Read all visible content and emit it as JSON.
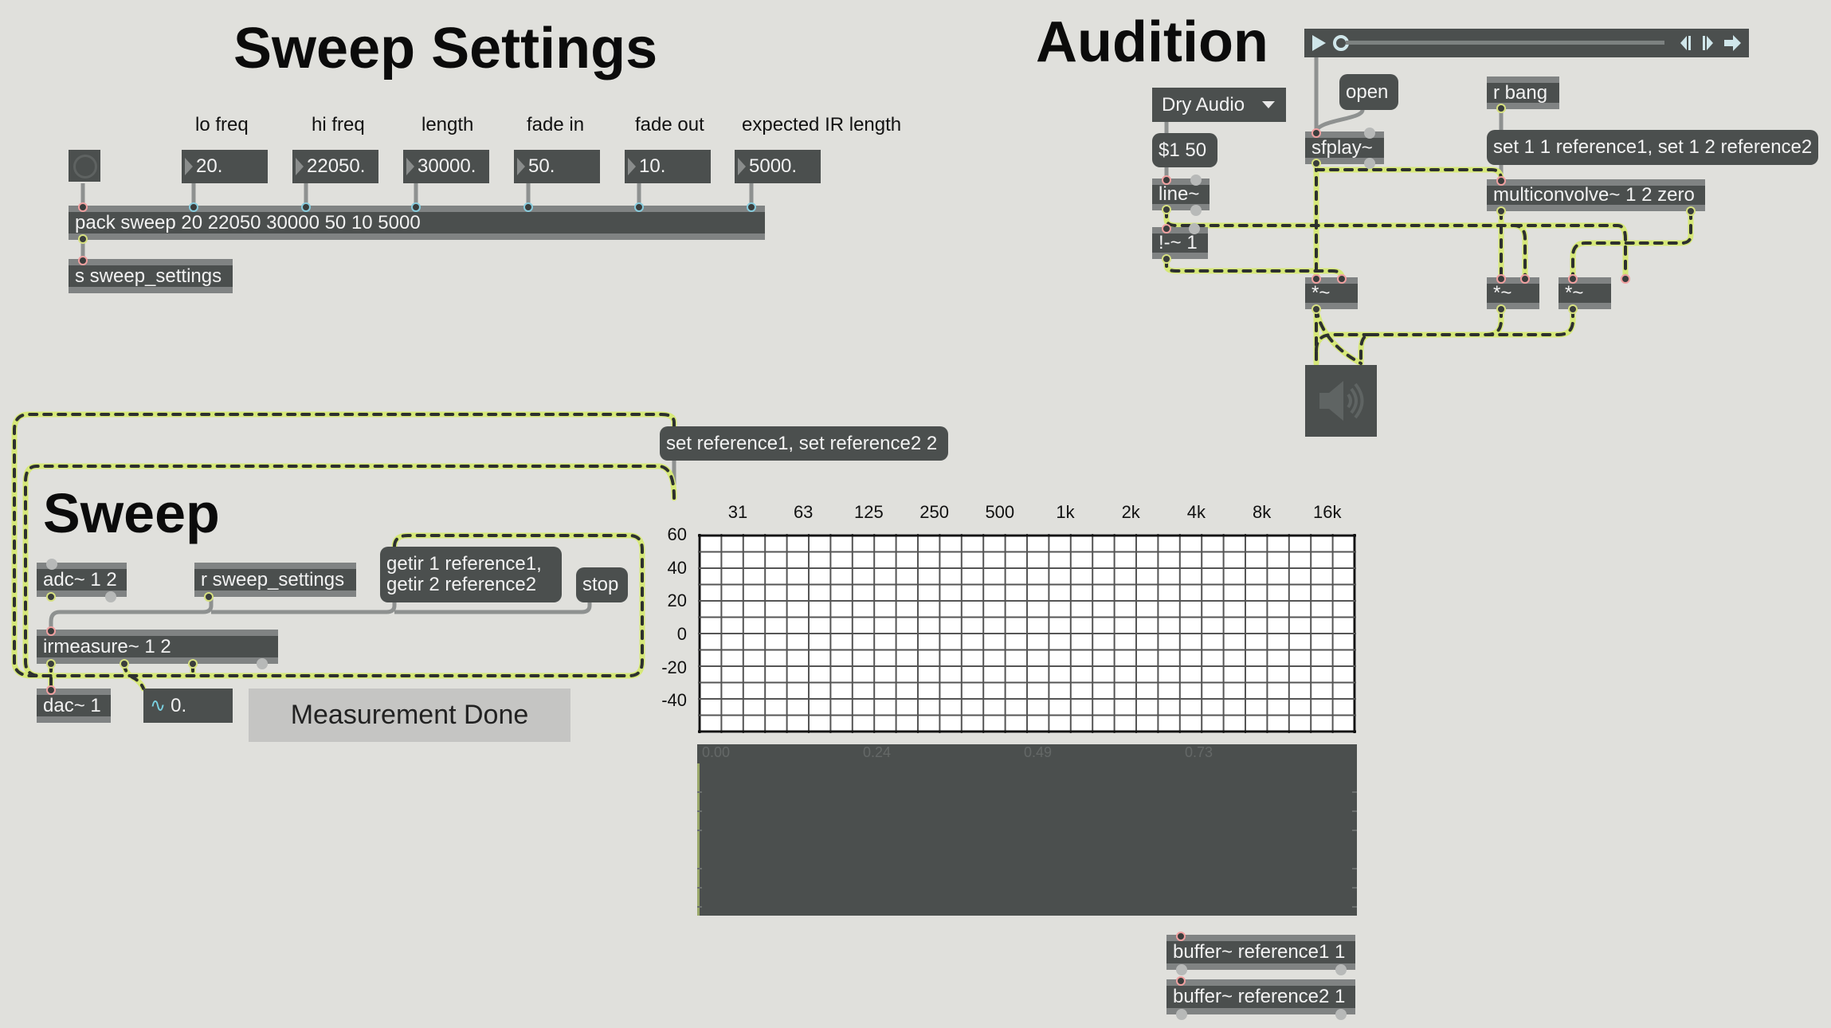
{
  "headings": {
    "sweep_settings": "Sweep Settings",
    "audition": "Audition",
    "sweep": "Sweep"
  },
  "sweep_settings": {
    "param_labels": [
      "lo freq",
      "hi freq",
      "length",
      "fade in",
      "fade out",
      "expected IR length"
    ],
    "param_values": [
      "20.",
      "22050.",
      "30000.",
      "50.",
      "10.",
      "5000."
    ],
    "pack_object": "pack sweep 20 22050 30000 50 10 5000",
    "send_object": "s sweep_settings"
  },
  "audition": {
    "player": {
      "position": 0.0,
      "icons": [
        "play-icon",
        "scrub-handle",
        "step-back-icon",
        "step-forward-icon",
        "loop-icon"
      ]
    },
    "menu_selected": "Dry Audio",
    "open_msg": "open",
    "r_bang": "r bang",
    "msg_ramp": "$1 50",
    "sfplay": "sfplay~",
    "set_msg": "set 1 1 reference1, set 1 2 reference2",
    "line": "line~",
    "multiconvolve": "multiconvolve~ 1 2 zero",
    "inverse": "!-~ 1",
    "multiply": "*~"
  },
  "sweep": {
    "set_ref_msg": "set reference1, set reference2 2",
    "adc": "adc~ 1 2",
    "r_settings": "r sweep_settings",
    "getir_msg_line1": "getir 1 reference1,",
    "getir_msg_line2": "getir 2 reference2",
    "stop_msg": "stop",
    "irmeasure": "irmeasure~ 1 2",
    "dac": "dac~ 1",
    "signal_value": "0.",
    "status_button": "Measurement Done"
  },
  "chart_data": [
    {
      "type": "line",
      "title": "",
      "x_tick_labels": [
        "31",
        "63",
        "125",
        "250",
        "500",
        "1k",
        "2k",
        "4k",
        "8k",
        "16k"
      ],
      "y_tick_labels": [
        "60",
        "40",
        "20",
        "0",
        "-20",
        "-40"
      ],
      "ylim": [
        -60,
        60
      ],
      "grid": true,
      "series": []
    },
    {
      "type": "line",
      "title": "",
      "x_tick_labels": [
        "0.00",
        "0.24",
        "0.49",
        "0.73"
      ],
      "grid": false,
      "series": []
    }
  ],
  "buffers": [
    "buffer~ reference1 1",
    "buffer~ reference2 1"
  ],
  "colors": {
    "background": "#e0e0dc",
    "object_fill": "#4b4f4e",
    "object_border": "#808383",
    "signal_cord": "#d6e878",
    "cord_dash": "#2d302f",
    "hot_inlet": "#f0a0a0",
    "cold_inlet": "#88ccdd",
    "outlet": "#d6e080"
  }
}
